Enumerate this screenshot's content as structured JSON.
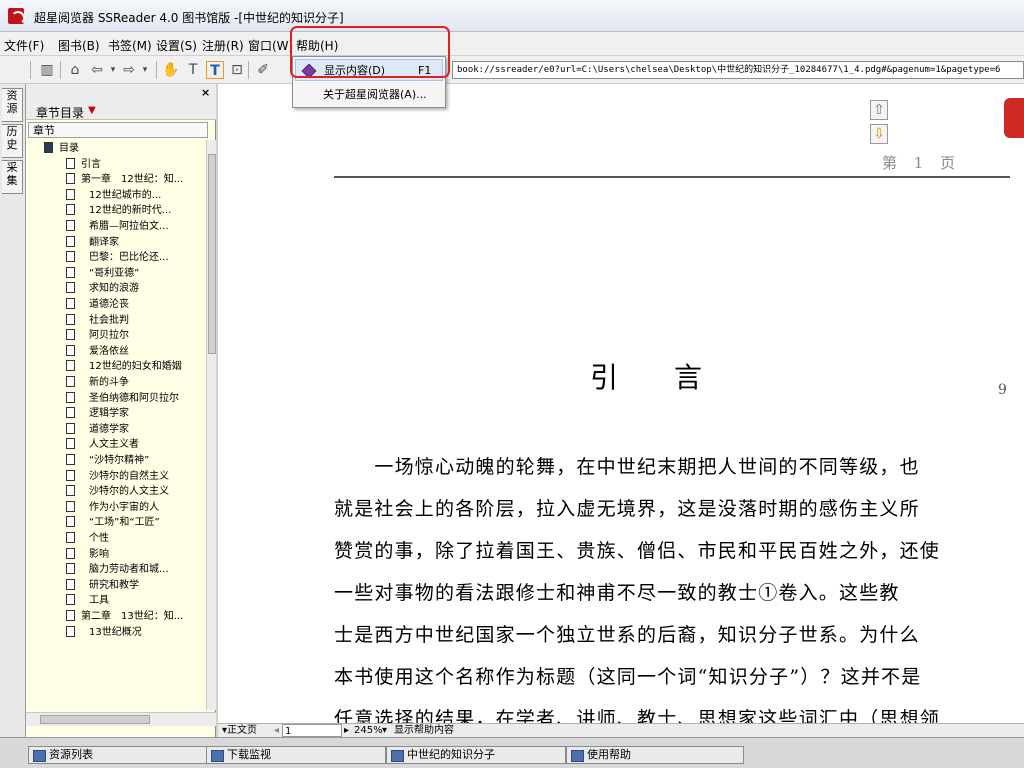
{
  "window": {
    "title": "超星阅览器 SSReader 4.0 图书馆版 -[中世纪的知识分子]"
  },
  "menubar": {
    "items": [
      "文件(F)",
      "图书(B)",
      "书签(M)",
      "设置(S)",
      "注册(R)",
      "窗口(W)",
      "帮助(H)"
    ]
  },
  "help_menu": {
    "items": [
      {
        "label": "显示内容(D)",
        "shortcut": "F1"
      },
      {
        "label": "关于超星阅览器(A)...",
        "shortcut": ""
      }
    ]
  },
  "toolbar": {
    "address": "book://ssreader/e0?url=C:\\Users\\chelsea\\Desktop\\中世纪的知识分子_10284677\\1_4.pdg#&pagenum=1&pagetype=6"
  },
  "side_tabs": [
    "资源",
    "历史",
    "采集"
  ],
  "panel": {
    "title": "章节目录",
    "column_header": "章节",
    "tree": [
      {
        "label": "目录",
        "level": 0
      },
      {
        "label": "引言",
        "level": 1
      },
      {
        "label": "第一章　12世纪：知...",
        "level": 1
      },
      {
        "label": "12世纪城市的...",
        "level": 2
      },
      {
        "label": "12世纪的新时代...",
        "level": 2
      },
      {
        "label": "希腊—阿拉伯文...",
        "level": 2
      },
      {
        "label": "翻译家",
        "level": 2
      },
      {
        "label": "巴黎：巴比伦还...",
        "level": 2
      },
      {
        "label": "“哥利亚德”",
        "level": 2
      },
      {
        "label": "求知的浪游",
        "level": 2
      },
      {
        "label": "道德沦丧",
        "level": 2
      },
      {
        "label": "社会批判",
        "level": 2
      },
      {
        "label": "阿贝拉尔",
        "level": 2
      },
      {
        "label": "爱洛依丝",
        "level": 2
      },
      {
        "label": "12世纪的妇女和婚姻",
        "level": 2
      },
      {
        "label": "新的斗争",
        "level": 2
      },
      {
        "label": "圣伯纳德和阿贝拉尔",
        "level": 2
      },
      {
        "label": "逻辑学家",
        "level": 2
      },
      {
        "label": "道德学家",
        "level": 2
      },
      {
        "label": "人文主义者",
        "level": 2
      },
      {
        "label": "“沙特尔精神”",
        "level": 2
      },
      {
        "label": "沙特尔的自然主义",
        "level": 2
      },
      {
        "label": "沙特尔的人文主义",
        "level": 2
      },
      {
        "label": "作为小宇宙的人",
        "level": 2
      },
      {
        "label": "“工场”和“工匠”",
        "level": 2
      },
      {
        "label": "个性",
        "level": 2
      },
      {
        "label": "影响",
        "level": 2
      },
      {
        "label": "脑力劳动者和城...",
        "level": 2
      },
      {
        "label": "研究和教学",
        "level": 2
      },
      {
        "label": "工具",
        "level": 2
      },
      {
        "label": "第二章　13世纪：知...",
        "level": 1
      },
      {
        "label": "13世纪概况",
        "level": 2
      }
    ]
  },
  "document": {
    "page_header": "第 1 页",
    "side_page_number": "9",
    "chapter_heading": "引言",
    "lines": [
      "　　一场惊心动魄的轮舞，在中世纪末期把人世间的不同等级，也",
      "就是社会上的各阶层，拉入虚无境界，这是没落时期的感伤主义所",
      "赞赏的事，除了拉着国王、贵族、僧侣、市民和平民百姓之外，还使",
      "一些对事物的看法跟修士和神甫不尽一致的教士①卷入。这些教",
      "士是西方中世纪国家一个独立世系的后裔，知识分子世系。为什么",
      "本书使用这个名称作为标题（这同一个词“知识分子”）？这并不是",
      "任意选择的结果，在学者、讲师、教士、思想家这些词汇中（思想领"
    ]
  },
  "doc_controls": {
    "view_mode": "正文页",
    "page_input": "1",
    "zoom": "245%",
    "status_text": "显示帮助内容"
  },
  "statusbar": {
    "tabs": [
      "资源列表",
      "下载监视",
      "中世纪的知识分子",
      "使用帮助"
    ]
  },
  "colors": {
    "highlight_border": "#e0201c",
    "panel_background": "#ffffe6"
  }
}
